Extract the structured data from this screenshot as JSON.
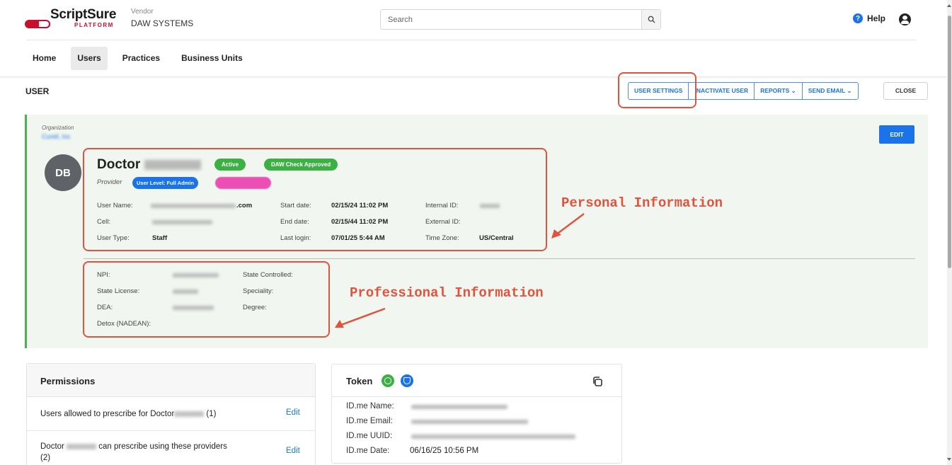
{
  "header": {
    "logo_text": "ScriptSure",
    "logo_sub": "PLATFORM",
    "vendor_label": "Vendor",
    "vendor_name": "DAW SYSTEMS",
    "search_placeholder": "Search",
    "help_label": "Help"
  },
  "nav": [
    {
      "label": "Home",
      "active": false
    },
    {
      "label": "Users",
      "active": true
    },
    {
      "label": "Practices",
      "active": false
    },
    {
      "label": "Business Units",
      "active": false
    }
  ],
  "page": {
    "title": "USER",
    "actions": [
      "USER SETTINGS",
      "INACTIVATE USER",
      "REPORTS ⌄",
      "SEND EMAIL ⌄"
    ],
    "close_label": "CLOSE"
  },
  "user": {
    "org_label": "Organization",
    "org_name": "Curell, Inc",
    "edit_label": "EDIT",
    "initials": "DB",
    "name_prefix": "Doctor",
    "status_badge": "Active",
    "check_badge": "DAW Check Approved",
    "role": "Provider",
    "level_badge": "User Level: Full Admin",
    "fields": {
      "user_name_label": "User Name:",
      "user_name_suffix": ".com",
      "cell_label": "Cell:",
      "user_type_label": "User Type:",
      "user_type": "Staff",
      "start_label": "Start date:",
      "start": "02/15/24 11:02 PM",
      "end_label": "End date:",
      "end": "02/15/44 11:02 PM",
      "login_label": "Last login:",
      "login": "07/01/25 5:44 AM",
      "internal_label": "Internal ID:",
      "external_label": "External ID:",
      "tz_label": "Time Zone:",
      "tz": "US/Central"
    },
    "professional": {
      "npi_label": "NPI:",
      "license_label": "State License:",
      "dea_label": "DEA:",
      "detox_label": "Detox (NADEAN):",
      "controlled_label": "State Controlled:",
      "speciality_label": "Speciality:",
      "degree_label": "Degree:"
    }
  },
  "annotations": {
    "personal": "Personal Information",
    "professional": "Professional Information",
    "color": "#e0533d"
  },
  "permissions": {
    "title": "Permissions",
    "row1_a": "Users allowed to prescribe for Doctor",
    "row1_b": "(1)",
    "row2_a": "Doctor",
    "row2_b": "can prescribe using these providers",
    "row2_c": "(2)",
    "edit_label": "Edit"
  },
  "token": {
    "title": "Token",
    "name_label": "ID.me Name:",
    "email_label": "ID.me Email:",
    "uuid_label": "ID.me UUID:",
    "date_label": "ID.me Date:",
    "date": "06/16/25 10:56 PM"
  }
}
